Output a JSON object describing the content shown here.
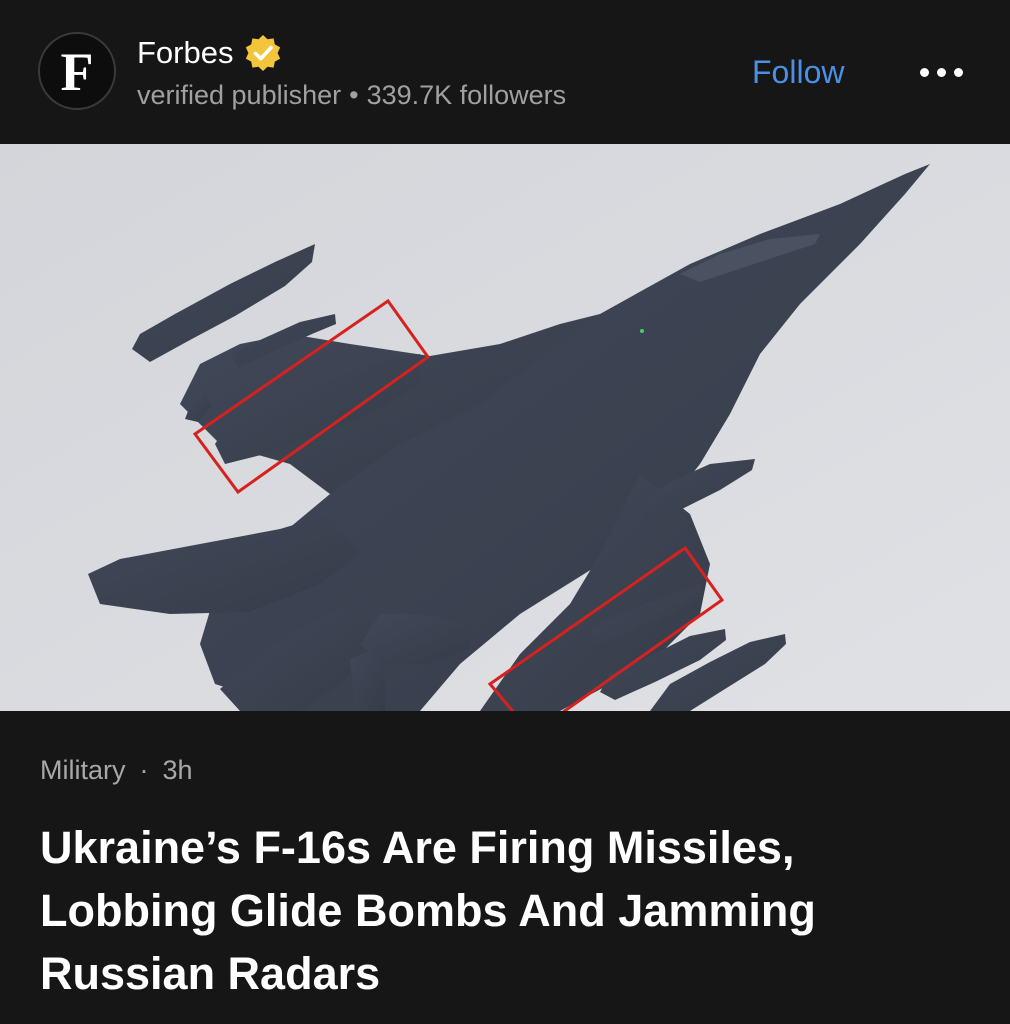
{
  "publisher": {
    "logo_letter": "F",
    "name": "Forbes",
    "meta": "verified publisher",
    "followers": "339.7K followers"
  },
  "actions": {
    "follow_label": "Follow"
  },
  "colors": {
    "background": "#161616",
    "follow_accent": "#4a90e6",
    "verified_badge": "#f2c53d",
    "highlight_box": "#d6221f",
    "sky": "#d8dadf",
    "aircraft": "#3b4250"
  },
  "icons": {
    "verified": "verified-badge-icon",
    "more": "more-dots-icon"
  },
  "article": {
    "category": "Military",
    "age": "3h",
    "headline": "Ukraine’s F-16s Are Firing Missiles, Lobbing Glide Bombs And Jamming Russian Radars"
  }
}
